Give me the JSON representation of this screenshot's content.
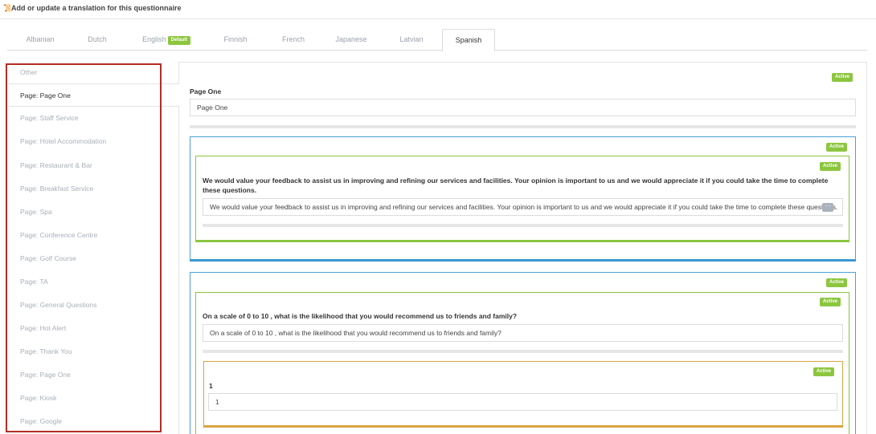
{
  "header": {
    "icon": "document-icon",
    "title": "Add or update a translation for this questionnaire"
  },
  "tabs": [
    {
      "label": "Albanian"
    },
    {
      "label": "Dutch"
    },
    {
      "label": "English",
      "badge": "Default"
    },
    {
      "label": "Finnish"
    },
    {
      "label": "French"
    },
    {
      "label": "Japanese"
    },
    {
      "label": "Latvian"
    },
    {
      "label": "Spanish",
      "active": true
    }
  ],
  "sidebar": {
    "items": [
      {
        "label": "Other"
      },
      {
        "label": "Page: Page One",
        "active": true
      },
      {
        "label": "Page: Staff Service"
      },
      {
        "label": "Page: Hotel Accommodation"
      },
      {
        "label": "Page: Restaurant & Bar"
      },
      {
        "label": "Page: Breakfast Service"
      },
      {
        "label": "Page: Spa"
      },
      {
        "label": "Page: Conference Centre"
      },
      {
        "label": "Page: Golf Course"
      },
      {
        "label": "Page: TA"
      },
      {
        "label": "Page: General Questions"
      },
      {
        "label": "Page: Hot Alert"
      },
      {
        "label": "Page: Thank You"
      },
      {
        "label": "Page: Page One"
      },
      {
        "label": "Page: Kiosk"
      },
      {
        "label": "Page: Google"
      }
    ]
  },
  "main": {
    "status_badge": "Active",
    "page_label": "Page One",
    "page_value": "Page One",
    "section1": {
      "status_badge": "Active",
      "question": {
        "status_badge": "Active",
        "label": "We would value your feedback to assist us in improving and refining our services and facilities. Your opinion is important to us and we would appreciate it if you could take the time to complete these questions.",
        "value": "We would value your feedback to assist us in improving and refining our services and facilities. Your opinion is important to us and we would appreciate it if you could take the time to complete these questions."
      }
    },
    "section2": {
      "status_badge": "Active",
      "question": {
        "status_badge": "Active",
        "label": "On a scale of 0 to 10 , what is the likelihood that you would recommend us to friends and family?",
        "value": "On a scale of 0 to 10 , what is the likelihood that you would recommend us to friends and family?",
        "option": {
          "status_badge": "Active",
          "label": "1",
          "value": "1"
        }
      }
    }
  },
  "colors": {
    "active_green": "#8cc63f",
    "highlight_red": "#b32d24",
    "section_blue": "#3a97cf",
    "option_orange": "#d9a540"
  }
}
